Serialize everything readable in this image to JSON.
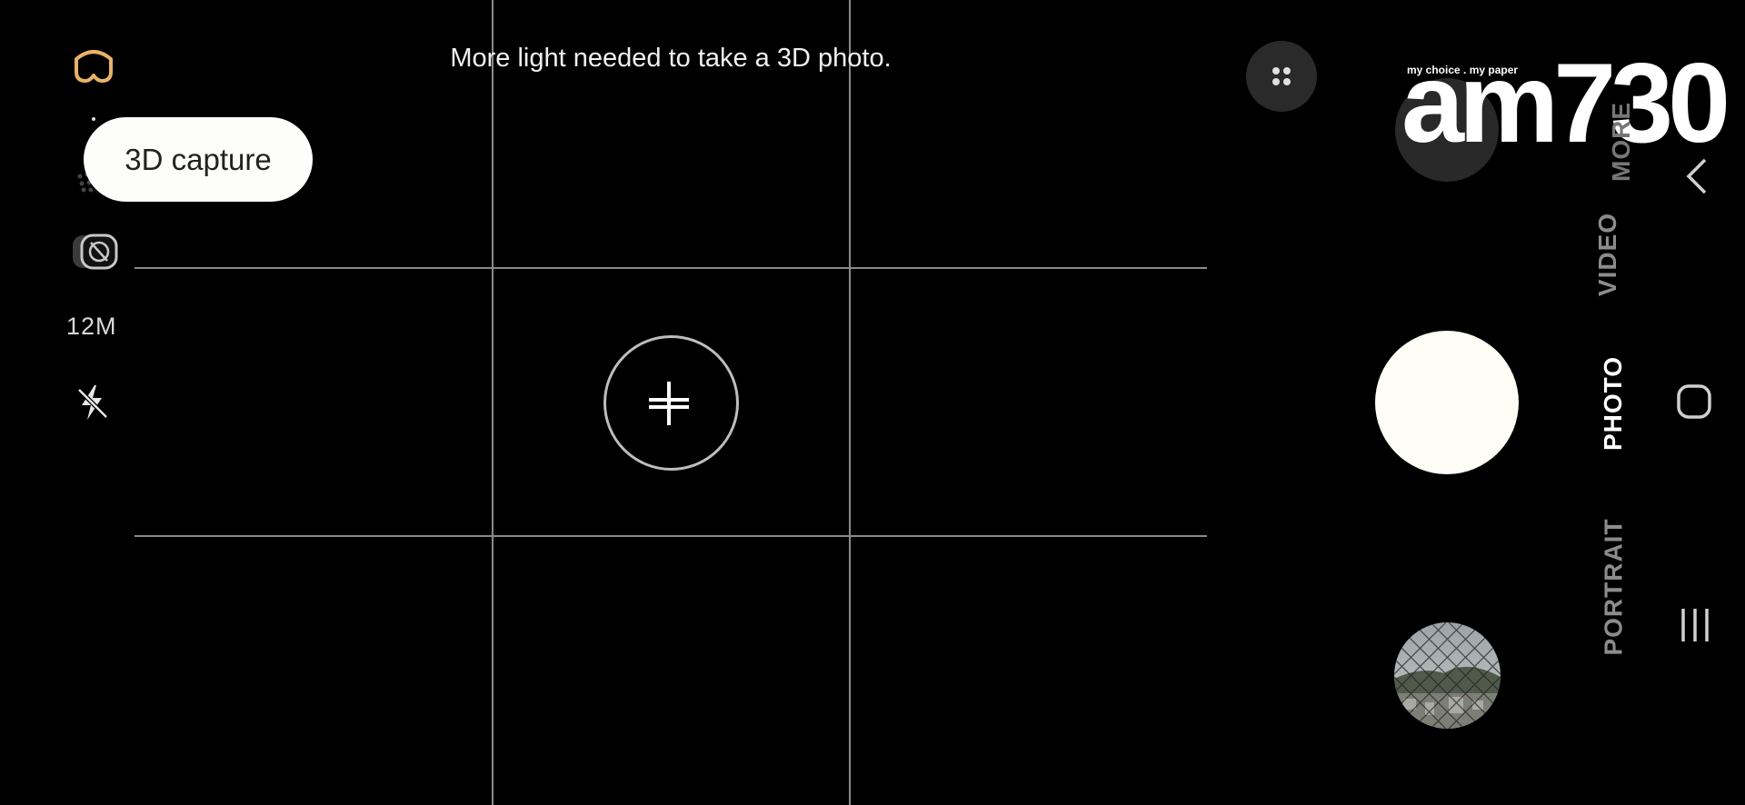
{
  "status": {
    "hint_text": "More light needed to take a 3D photo."
  },
  "left_toolbar": {
    "icons": [
      "vr-3d-icon",
      "filters-icon",
      "lens-off-icon",
      "flash-off-icon"
    ],
    "resolution_label": "12M",
    "popup_label": "3D capture"
  },
  "top_right": {
    "more_icon": "four-dots-icon"
  },
  "watermark": {
    "tagline": "my choice . my paper",
    "brand": "am730"
  },
  "modes": {
    "items": [
      "MORE",
      "VIDEO",
      "PHOTO",
      "PORTRAIT"
    ],
    "selected": "PHOTO"
  },
  "colors": {
    "accent_icon": "#e8b26a",
    "shutter": "#fdfdf5",
    "grid": "#8a8a8a",
    "pill_bg": "#fdfdfb"
  },
  "nav": {
    "icons": [
      "back-icon",
      "home-icon",
      "recents-icon"
    ]
  }
}
